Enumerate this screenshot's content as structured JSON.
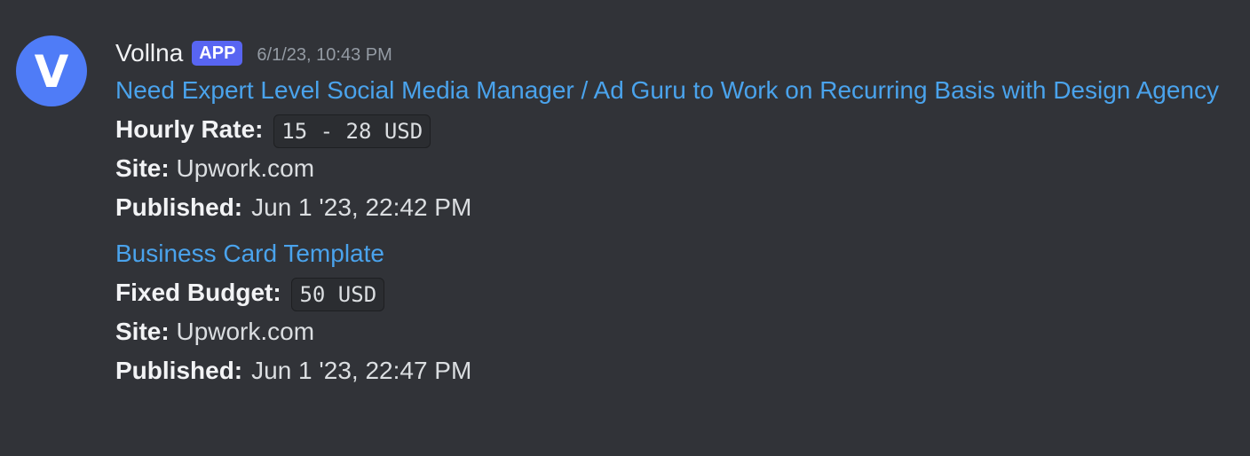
{
  "message": {
    "avatar_letter": "V",
    "username": "Vollna",
    "badge": "APP",
    "timestamp": "6/1/23, 10:43 PM"
  },
  "jobs": [
    {
      "title": "Need Expert Level Social Media Manager / Ad Guru to Work on Recurring Basis with Design Agency",
      "rate_label": "Hourly Rate:",
      "rate_value": "15 - 28 USD",
      "site_label": "Site:",
      "site_value": "Upwork.com",
      "published_label": "Published:",
      "published_value": "Jun 1 '23, 22:42 PM"
    },
    {
      "title": "Business Card Template",
      "rate_label": "Fixed Budget:",
      "rate_value": "50 USD",
      "site_label": "Site:",
      "site_value": "Upwork.com",
      "published_label": "Published:",
      "published_value": "Jun 1 '23, 22:47 PM"
    }
  ],
  "colors": {
    "background": "#313338",
    "avatar": "#4f7cf7",
    "link": "#4aa3ec",
    "badge": "#5865f2",
    "timestamp": "#949ba4"
  }
}
